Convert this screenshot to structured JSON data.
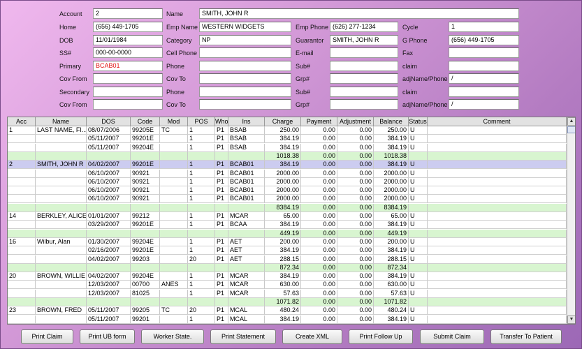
{
  "form": {
    "account_label": "Account",
    "account": "2",
    "name_label": "Name",
    "name": "SMITH, JOHN R",
    "home_label": "Home",
    "home": "(656) 449-1705",
    "emp_name_label": "Emp Name",
    "emp_name": "WESTERN WIDGETS",
    "emp_phone_label": "Emp Phone",
    "emp_phone": "(626) 277-1234",
    "cycle_label": "Cycle",
    "cycle": "1",
    "dob_label": "DOB",
    "dob": "11/01/1984",
    "category_label": "Category",
    "category": "NP",
    "guarantor_label": "Guarantor",
    "guarantor": "SMITH, JOHN R",
    "gphone_label": "G Phone",
    "gphone": "(656) 449-1705",
    "ss_label": "SS#",
    "ss": "000-00-0000",
    "cell_label": "Cell Phone",
    "cell": "",
    "email_label": "E-mail",
    "email": "",
    "fax_label": "Fax",
    "fax": "",
    "primary_label": "Primary",
    "primary": "BCAB01",
    "phone1_label": "Phone",
    "phone1": "",
    "sub1_label": "Sub#",
    "sub1": "",
    "claim1_label": "claim",
    "claim1": "",
    "covfrom1_label": "Cov From",
    "covfrom1": "",
    "covto1_label": "Cov To",
    "covto1": "",
    "grp1_label": "Grp#",
    "grp1": "",
    "adj1_label": "adjName/Phone",
    "adj1": "/",
    "secondary_label": "Secondary",
    "secondary": "",
    "phone2_label": "Phone",
    "phone2": "",
    "sub2_label": "Sub#",
    "sub2": "",
    "claim2_label": "claim",
    "claim2": "",
    "covfrom2_label": "Cov From",
    "covfrom2": "",
    "covto2_label": "Cov To",
    "covto2": "",
    "grp2_label": "Grp#",
    "grp2": "",
    "adj2_label": "adjName/Phone",
    "adj2": "/"
  },
  "table": {
    "headers": [
      "Acc",
      "Name",
      "DOS",
      "Code",
      "Mod",
      "POS",
      "Who",
      "Ins",
      "Charge",
      "Payment",
      "Adjustment",
      "Balance",
      "Status",
      "Comment"
    ],
    "rows": [
      {
        "type": "item",
        "cells": [
          "1",
          "LAST NAME, FI...",
          "08/07/2006",
          "99205E",
          "TC",
          "1",
          "P1",
          "BSAB",
          "250.00",
          "0.00",
          "0.00",
          "250.00",
          "U",
          ""
        ]
      },
      {
        "type": "item",
        "cells": [
          "",
          "",
          "05/11/2007",
          "99201E",
          "",
          "1",
          "P1",
          "BSAB",
          "384.19",
          "0.00",
          "0.00",
          "384.19",
          "U",
          ""
        ]
      },
      {
        "type": "item",
        "cells": [
          "",
          "",
          "05/11/2007",
          "99204E",
          "",
          "1",
          "P1",
          "BSAB",
          "384.19",
          "0.00",
          "0.00",
          "384.19",
          "U",
          ""
        ]
      },
      {
        "type": "total",
        "cells": [
          "",
          "",
          "",
          "",
          "",
          "",
          "",
          "",
          "1018.38",
          "0.00",
          "0.00",
          "1018.38",
          "",
          ""
        ]
      },
      {
        "type": "sel",
        "cells": [
          "2",
          "SMITH, JOHN R",
          "04/02/2007",
          "99201E",
          "",
          "1",
          "P1",
          "BCAB01",
          "384.19",
          "0.00",
          "0.00",
          "384.19",
          "U",
          ""
        ]
      },
      {
        "type": "item",
        "cells": [
          "",
          "",
          "06/10/2007",
          "90921",
          "",
          "1",
          "P1",
          "BCAB01",
          "2000.00",
          "0.00",
          "0.00",
          "2000.00",
          "U",
          ""
        ]
      },
      {
        "type": "item",
        "cells": [
          "",
          "",
          "06/10/2007",
          "90921",
          "",
          "1",
          "P1",
          "BCAB01",
          "2000.00",
          "0.00",
          "0.00",
          "2000.00",
          "U",
          ""
        ]
      },
      {
        "type": "item",
        "cells": [
          "",
          "",
          "06/10/2007",
          "90921",
          "",
          "1",
          "P1",
          "BCAB01",
          "2000.00",
          "0.00",
          "0.00",
          "2000.00",
          "U",
          ""
        ]
      },
      {
        "type": "item",
        "cells": [
          "",
          "",
          "06/10/2007",
          "90921",
          "",
          "1",
          "P1",
          "BCAB01",
          "2000.00",
          "0.00",
          "0.00",
          "2000.00",
          "U",
          ""
        ]
      },
      {
        "type": "total",
        "cells": [
          "",
          "",
          "",
          "",
          "",
          "",
          "",
          "",
          "8384.19",
          "0.00",
          "0.00",
          "8384.19",
          "",
          ""
        ]
      },
      {
        "type": "item",
        "cells": [
          "14",
          "BERKLEY, ALICE",
          "01/01/2007",
          "99212",
          "",
          "1",
          "P1",
          "MCAR",
          "65.00",
          "0.00",
          "0.00",
          "65.00",
          "U",
          ""
        ]
      },
      {
        "type": "item",
        "cells": [
          "",
          "",
          "03/29/2007",
          "99201E",
          "",
          "1",
          "P1",
          "BCAA",
          "384.19",
          "0.00",
          "0.00",
          "384.19",
          "U",
          ""
        ]
      },
      {
        "type": "total",
        "cells": [
          "",
          "",
          "",
          "",
          "",
          "",
          "",
          "",
          "449.19",
          "0.00",
          "0.00",
          "449.19",
          "",
          ""
        ]
      },
      {
        "type": "item",
        "cells": [
          "16",
          "Wilbur, Alan",
          "01/30/2007",
          "99204E",
          "",
          "1",
          "P1",
          "AET",
          "200.00",
          "0.00",
          "0.00",
          "200.00",
          "U",
          ""
        ]
      },
      {
        "type": "item",
        "cells": [
          "",
          "",
          "02/16/2007",
          "99201E",
          "",
          "1",
          "P1",
          "AET",
          "384.19",
          "0.00",
          "0.00",
          "384.19",
          "U",
          ""
        ]
      },
      {
        "type": "item",
        "cells": [
          "",
          "",
          "04/02/2007",
          "99203",
          "",
          "20",
          "P1",
          "AET",
          "288.15",
          "0.00",
          "0.00",
          "288.15",
          "U",
          ""
        ]
      },
      {
        "type": "total",
        "cells": [
          "",
          "",
          "",
          "",
          "",
          "",
          "",
          "",
          "872.34",
          "0.00",
          "0.00",
          "872.34",
          "",
          ""
        ]
      },
      {
        "type": "item",
        "cells": [
          "20",
          "BROWN, WILLIE J",
          "04/02/2007",
          "99204E",
          "",
          "1",
          "P1",
          "MCAR",
          "384.19",
          "0.00",
          "0.00",
          "384.19",
          "U",
          ""
        ]
      },
      {
        "type": "item",
        "cells": [
          "",
          "",
          "12/03/2007",
          "00700",
          "ANES",
          "1",
          "P1",
          "MCAR",
          "630.00",
          "0.00",
          "0.00",
          "630.00",
          "U",
          ""
        ]
      },
      {
        "type": "item",
        "cells": [
          "",
          "",
          "12/03/2007",
          "81025",
          "",
          "1",
          "P1",
          "MCAR",
          "57.63",
          "0.00",
          "0.00",
          "57.63",
          "U",
          ""
        ]
      },
      {
        "type": "total",
        "cells": [
          "",
          "",
          "",
          "",
          "",
          "",
          "",
          "",
          "1071.82",
          "0.00",
          "0.00",
          "1071.82",
          "",
          ""
        ]
      },
      {
        "type": "item",
        "cells": [
          "23",
          "BROWN, FRED",
          "05/11/2007",
          "99205",
          "TC",
          "20",
          "P1",
          "MCAL",
          "480.24",
          "0.00",
          "0.00",
          "480.24",
          "U",
          ""
        ]
      },
      {
        "type": "item",
        "cells": [
          "",
          "",
          "05/11/2007",
          "99201",
          "",
          "1",
          "P1",
          "MCAL",
          "384.19",
          "0.00",
          "0.00",
          "384.19",
          "U",
          ""
        ]
      }
    ]
  },
  "buttons": {
    "print_claim": "Print Claim",
    "print_ub": "Print UB form",
    "worker_state": "Worker State.",
    "print_statement": "Print Statement",
    "create_xml": "Create XML",
    "print_follow_up": "Print Follow Up",
    "submit_claim": "Submit Claim",
    "transfer_to_patient": "Transfer To Patient"
  },
  "colors": {
    "total_row": "#d8f5d0",
    "selected_row": "#ccccf0",
    "primary_text": "#e01010"
  }
}
